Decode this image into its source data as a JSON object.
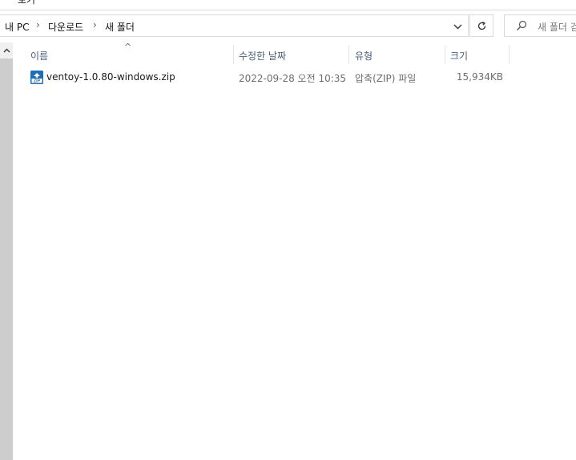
{
  "ribbon": {
    "partial_text": "보기"
  },
  "breadcrumb": {
    "items": [
      "내 PC",
      "다운로드",
      "새 폴더"
    ],
    "separator": "›"
  },
  "search": {
    "placeholder": "새 폴더 검색"
  },
  "columns": {
    "name": "이름",
    "modified": "수정한 날짜",
    "type": "유형",
    "size": "크기"
  },
  "files": [
    {
      "name": "ventoy-1.0.80-windows.zip",
      "modified": "2022-09-28 오전 10:35",
      "type": "압축(ZIP) 파일",
      "size": "15,934KB",
      "icon": "zip-icon"
    }
  ],
  "colors": {
    "header_text": "#4c607a",
    "zip_icon": "#1f6fb8"
  }
}
